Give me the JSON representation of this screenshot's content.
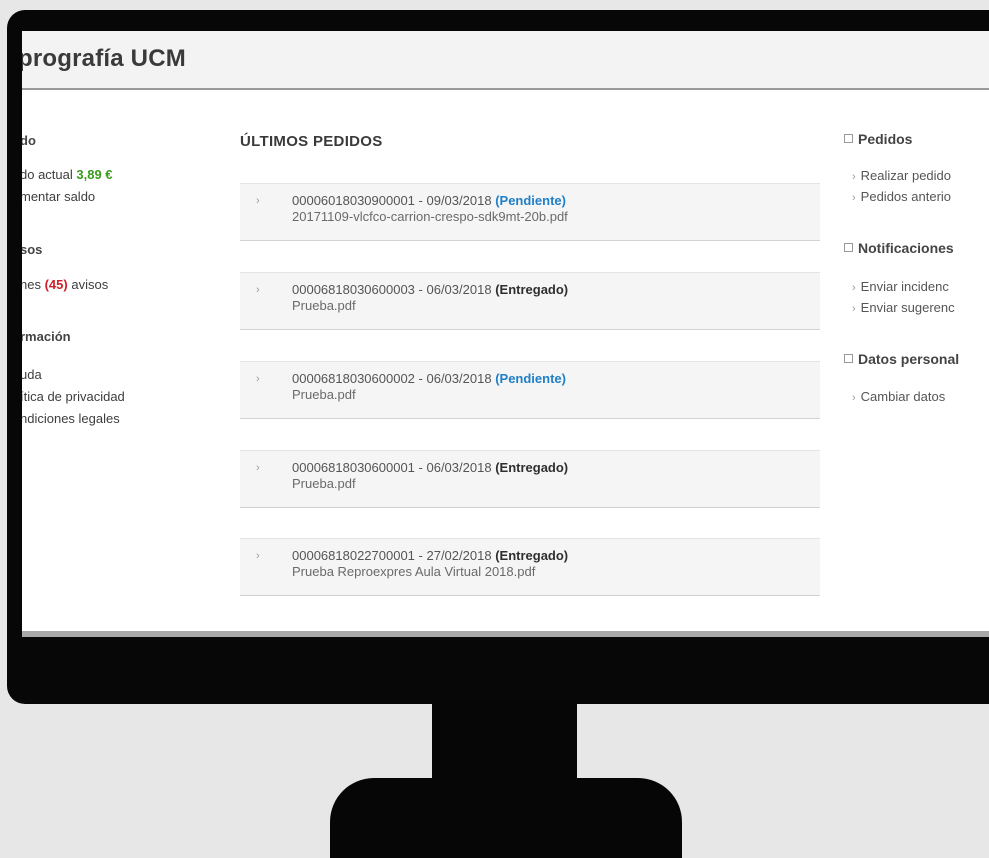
{
  "app": {
    "title": "prografía UCM"
  },
  "left": {
    "saldo_heading": "do",
    "saldo_label": "do actual",
    "saldo_value": "3,89 €",
    "aumentar": "mentar saldo",
    "avisos_heading": "sos",
    "avisos_prefix": "nes",
    "avisos_count": "(45)",
    "avisos_suffix": "avisos",
    "info_heading": "rmación",
    "ayuda": "uda",
    "privacidad": "ítica de privacidad",
    "legales": "ndiciones legales"
  },
  "main": {
    "section_title": "ÚLTIMOS PEDIDOS",
    "orders": [
      {
        "code": "00006018030900001",
        "date": "09/03/2018",
        "status": "(Pendiente)",
        "file": "20171109-vlcfco-carrion-crespo-sdk9mt-20b.pdf"
      },
      {
        "code": "00006818030600003",
        "date": "06/03/2018",
        "status": "(Entregado)",
        "file": "Prueba.pdf"
      },
      {
        "code": "00006818030600002",
        "date": "06/03/2018",
        "status": "(Pendiente)",
        "file": "Prueba.pdf"
      },
      {
        "code": "00006818030600001",
        "date": "06/03/2018",
        "status": "(Entregado)",
        "file": "Prueba.pdf"
      },
      {
        "code": "00006818022700001",
        "date": "27/02/2018",
        "status": "(Entregado)",
        "file": "Prueba Reproexpres Aula Virtual 2018.pdf"
      }
    ]
  },
  "right": {
    "pedidos_heading": "Pedidos",
    "realizar": "Realizar pedido",
    "anteriores": "Pedidos anterio",
    "notif_heading": "Notificaciones",
    "incidencia": "Enviar incidenc",
    "sugerencia": "Enviar sugerenc",
    "datos_heading": "Datos personal",
    "cambiar": "Cambiar datos"
  },
  "colors": {
    "positive": "#3c9a1f",
    "alert": "#cf2027",
    "pending": "#1f7fc7"
  }
}
